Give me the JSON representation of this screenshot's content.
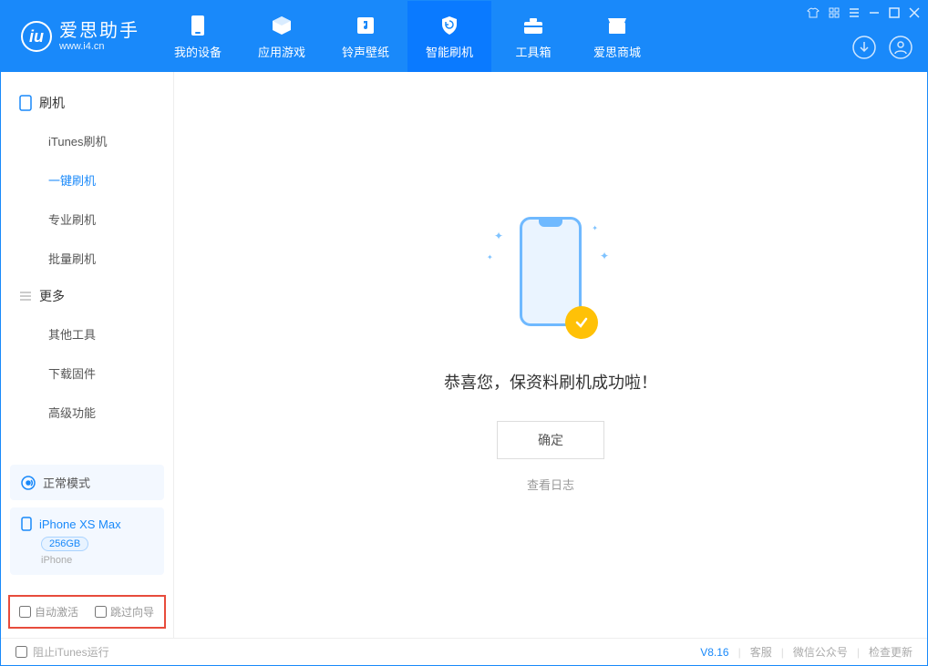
{
  "app": {
    "name": "爱思助手",
    "site": "www.i4.cn"
  },
  "nav": {
    "tabs": [
      {
        "label": "我的设备"
      },
      {
        "label": "应用游戏"
      },
      {
        "label": "铃声壁纸"
      },
      {
        "label": "智能刷机"
      },
      {
        "label": "工具箱"
      },
      {
        "label": "爱思商城"
      }
    ]
  },
  "sidebar": {
    "group1_title": "刷机",
    "group1_items": [
      "iTunes刷机",
      "一键刷机",
      "专业刷机",
      "批量刷机"
    ],
    "group2_title": "更多",
    "group2_items": [
      "其他工具",
      "下载固件",
      "高级功能"
    ],
    "mode": "正常模式",
    "device": {
      "name": "iPhone XS Max",
      "capacity": "256GB",
      "type": "iPhone"
    },
    "auto_activate": "自动激活",
    "skip_guide": "跳过向导"
  },
  "main": {
    "success": "恭喜您，保资料刷机成功啦！",
    "ok": "确定",
    "view_log": "查看日志"
  },
  "footer": {
    "block_itunes": "阻止iTunes运行",
    "version": "V8.16",
    "support": "客服",
    "wechat": "微信公众号",
    "check_update": "检查更新"
  }
}
